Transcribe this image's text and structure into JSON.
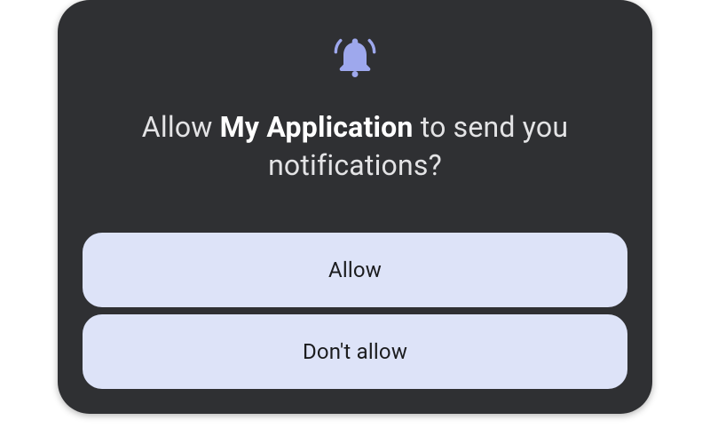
{
  "dialog": {
    "title_prefix": "Allow ",
    "app_name": "My Application",
    "title_suffix": " to send you notifications?",
    "icon": "bell-icon",
    "icon_color": "#9ea8ed",
    "allow_label": "Allow",
    "deny_label": "Don't allow"
  }
}
